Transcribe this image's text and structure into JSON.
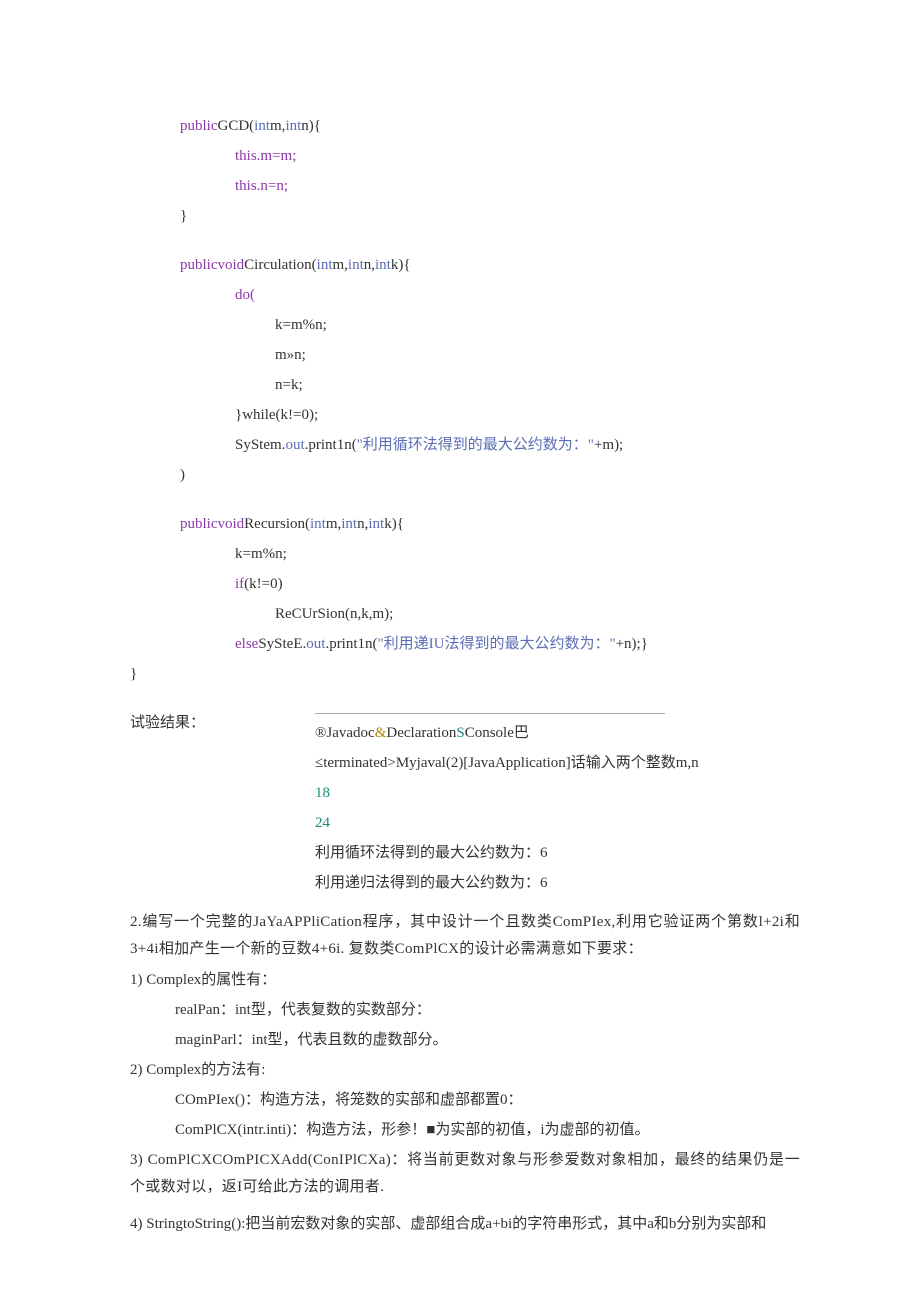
{
  "code": {
    "l1_pre": "public",
    "l1_mid": "GCD(",
    "l1_t1": "int",
    "l1_m": "m,",
    "l1_t2": "int",
    "l1_n": "n){",
    "l2": "this.m=m;",
    "l3": "this.n=n;",
    "l4": "}",
    "l5_pre": "publicvoid",
    "l5_mid": "Circulation(",
    "l5_t1": "int",
    "l5_m": "m,",
    "l5_t2": "int",
    "l5_n": "n,",
    "l5_t3": "int",
    "l5_k": "k){",
    "l6": "do(",
    "l7": "k=m%n;",
    "l8": "m»n;",
    "l9": "n=k;",
    "l10": "}while(k!=0);",
    "l11a": "SyStem.",
    "l11b": "out",
    "l11c": ".print1n(",
    "l11d": "\"利用循环法得到的最大公约数为：\"",
    "l11e": "+m);",
    "l12": ")",
    "l13_pre": "publicvoid",
    "l13_mid": "Recursion(",
    "l13_t1": "int",
    "l13_m": "m,",
    "l13_t2": "int",
    "l13_n": "n,",
    "l13_t3": "int",
    "l13_k": "k){",
    "l14": "k=m%n;",
    "l15a": "if",
    "l15b": "(k!=0)",
    "l16": "ReCUrSion(n,k,m);",
    "l17a": "else",
    "l17b": "SySteE.",
    "l17c": "out",
    "l17d": ".print1n(",
    "l17e": "\"利用递IU法得到的最大公约数为：\"",
    "l17f": "+n);}",
    "l18": "}"
  },
  "result": {
    "label": "试验结果：",
    "c1a": "®Javadoc",
    "c1b": "&",
    "c1c": "Declaration",
    "c1d": "S",
    "c1e": "Console巴",
    "c2": "≤terminated>Myjaval(2)[JavaApplication]话输入两个整数m,n",
    "c3": "18",
    "c4": "24",
    "c5": "利用循环法得到的最大公约数为：6",
    "c6": "利用递归法得到的最大公约数为：6"
  },
  "body": {
    "p1": "2.编写一个完整的JaYaAPPliCation程序，其中设计一个且数类ComPIex,利用它验证两个第数l+2i和3+4i相加产生一个新的豆数4+6i. 复数类ComPlCX的设计必需满意如下要求：",
    "li1": "1)    Complex的属性有：",
    "li1a": "realPan：int型，代表复数的实数部分：",
    "li1b": "maginParl：int型，代表且数的虚数部分。",
    "li2": "2)    Complex的方法有:",
    "li2a": "COmPIex()：构造方法，将笼数的实部和虚部都置0：",
    "li2b": "ComPlCX(intr.inti)：构造方法，形参！■为实部的初值，i为虚部的初值。",
    "li3": "3)      ComPlCXCOmPICXAdd(ConIPlCXa)：将当前更数对象与形参爱数对象相加，最终的结果仍是一个或数对以，返I可给此方法的调用者.",
    "li4": "4)      StringtoString():把当前宏数对象的实部、虚部组合成a+bi的字符串形式，其中a和b分别为实部和"
  }
}
